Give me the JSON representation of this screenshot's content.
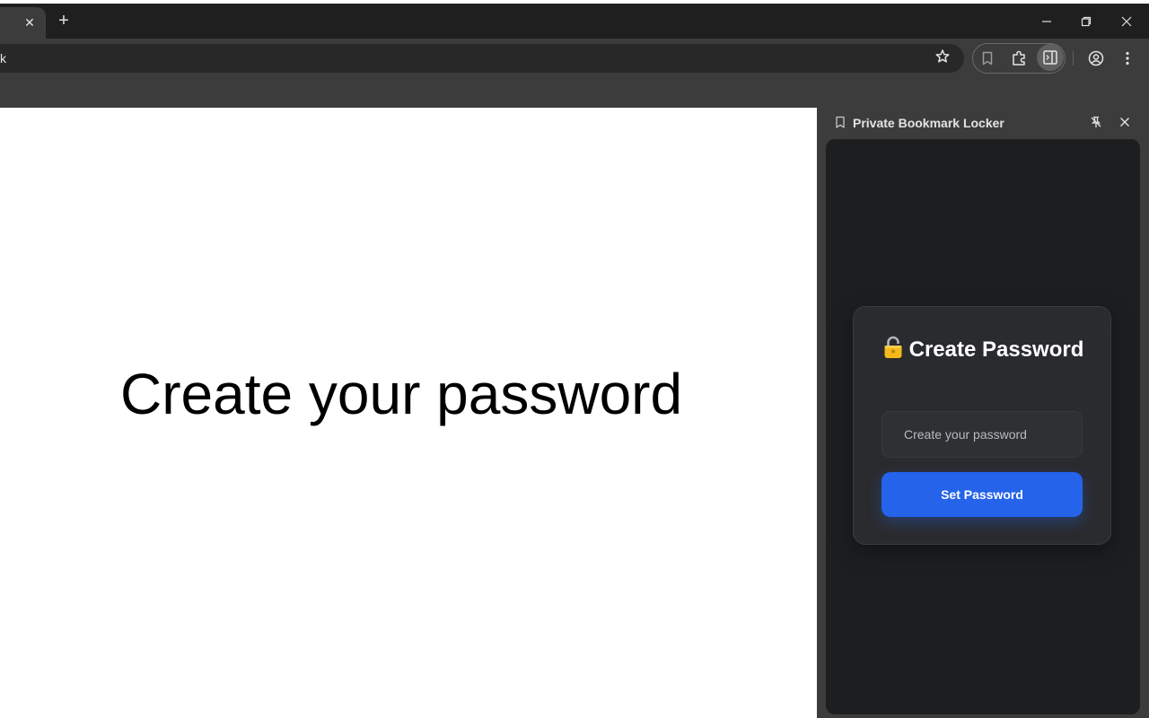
{
  "browser": {
    "tab_close_glyph": "✕",
    "new_tab_glyph": "+",
    "omnibox_text": "k",
    "window_controls": [
      "minimize-icon",
      "restore-icon",
      "close-icon"
    ],
    "toolbar_icons": [
      "star-icon",
      "bookmark-icon",
      "extensions-icon",
      "side-panel-icon",
      "profile-icon",
      "more-menu-icon"
    ]
  },
  "page": {
    "heading": "Create your password"
  },
  "side_panel": {
    "title": "Private Bookmark Locker",
    "icons": [
      "bookmark-icon",
      "unpin-icon",
      "close-icon"
    ],
    "card": {
      "title": "Create Password",
      "lock_icon": "lock-icon",
      "password_placeholder": "Create your password",
      "button_label": "Set Password"
    }
  },
  "colors": {
    "accent": "#2563eb",
    "panel_bg": "#1d1e20",
    "card_bg": "#2a2b2e",
    "chrome_dark": "#1f1f1f",
    "chrome_toolbar": "#3c3c3c"
  }
}
